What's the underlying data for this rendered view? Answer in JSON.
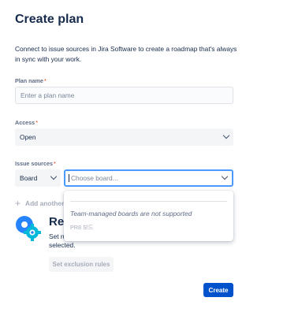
{
  "header": {
    "title": "Create plan",
    "description": "Connect to issue sources in Jira Software to create a roadmap that's always in sync with your work."
  },
  "form": {
    "plan_name": {
      "label": "Plan name",
      "required_mark": "*",
      "placeholder": "Enter a plan name",
      "value": ""
    },
    "access": {
      "label": "Access",
      "required_mark": "*",
      "value": "Open"
    },
    "issue_sources": {
      "label": "Issue sources",
      "required_mark": "*",
      "type_value": "Board",
      "board_placeholder": "Choose board..."
    },
    "add_another_label": "Add another"
  },
  "dropdown": {
    "notice": "Team-managed boards are not supported",
    "disabled_option": "PR8 보드"
  },
  "exclusions": {
    "title": "Ref",
    "text_line1": "Set ru",
    "text_line2": "selected.",
    "button_label": "Set exclusion rules"
  },
  "footer": {
    "create_label": "Create"
  },
  "colors": {
    "primary": "#0052cc",
    "focus": "#4c9aff",
    "required": "#de350b",
    "icon_blue": "#2684ff",
    "icon_teal": "#00b8d9"
  },
  "icons": {
    "add": "plus-icon",
    "dropdown": "chevron-down-icon",
    "exclusion_illustration": "gear-filter-icon"
  }
}
